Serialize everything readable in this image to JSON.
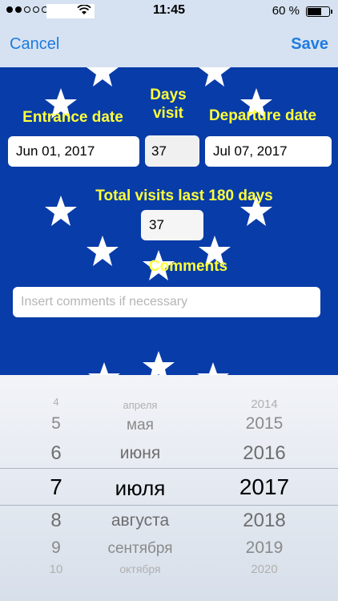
{
  "status": {
    "time": "11:45",
    "battery": "60 %",
    "battery_level": 0.6,
    "signal_bars_filled": 2,
    "signal_bars_total": 5,
    "icons": [
      "signal-dots-icon",
      "wifi-icon",
      "battery-icon"
    ]
  },
  "nav": {
    "cancel": "Cancel",
    "save": "Save"
  },
  "form": {
    "entrance_label": "Entrance date",
    "entrance_value": "Jun 01, 2017",
    "days_label_line1": "Days",
    "days_label_line2": "visit",
    "days_value": "37",
    "departure_label": "Departure date",
    "departure_value": "Jul 07, 2017",
    "total_label": "Total visits last 180 days",
    "total_value": "37",
    "comments_label": "Comments",
    "comments_placeholder": "Insert comments if necessary"
  },
  "picker": {
    "days": [
      "4",
      "5",
      "6",
      "7",
      "8",
      "9",
      "10"
    ],
    "months": [
      "апреля",
      "мая",
      "июня",
      "июля",
      "августа",
      "сентября",
      "октября"
    ],
    "years": [
      "2014",
      "2015",
      "2016",
      "2017",
      "2018",
      "2019",
      "2020"
    ],
    "selected_day": "7",
    "selected_month": "июля",
    "selected_year": "2017"
  },
  "colors": {
    "flag_blue": "#083ca8",
    "label_yellow": "#ffff3a",
    "nav_blue": "#1e7be0",
    "bar_bg": "#d6e2f1"
  }
}
